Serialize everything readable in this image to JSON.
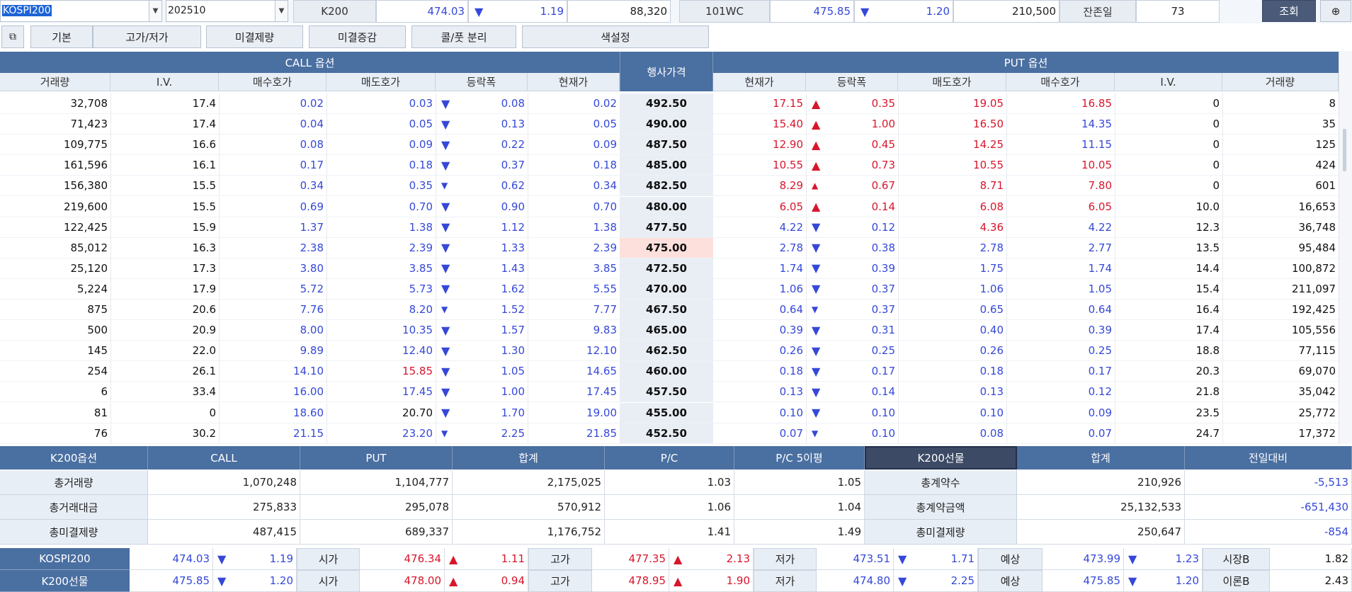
{
  "toolbar": {
    "underlying_value": "KOSPI200",
    "month_value": "202510",
    "k200_label": "K200",
    "k200_price": "474.03",
    "k200_change": "1.19",
    "k200_volume": "88,320",
    "future_label": "101WC",
    "future_price": "475.85",
    "future_change": "1.20",
    "future_volume": "210,500",
    "days_label": "잔존일",
    "days_value": "73",
    "query_button": "조회",
    "pin_icon": "⊕"
  },
  "tabs": [
    "기본",
    "고가/저가",
    "미결제량",
    "미결증감",
    "콜/풋 분리",
    "색설정"
  ],
  "grid": {
    "call_header": "CALL 옵션",
    "put_header": "PUT 옵션",
    "strike_header": "행사가격",
    "call_cols": [
      "거래량",
      "I.V.",
      "매수호가",
      "매도호가",
      "등락폭",
      "현재가"
    ],
    "put_cols": [
      "현재가",
      "등락폭",
      "매도호가",
      "매수호가",
      "I.V.",
      "거래량"
    ],
    "rows": [
      {
        "cv": "32,708",
        "civ": "17.4",
        "cb": "0.02",
        "ca": "0.03",
        "cchg": "0.08",
        "cp": "0.02",
        "k": "492.50",
        "pp": "17.15",
        "pchg": "0.35",
        "pa": "19.05",
        "pb": "16.85",
        "piv": "0",
        "pv": "8",
        "cdir": "dn",
        "pdir": "up",
        "csmall": false,
        "psmall": false,
        "ppc": "red",
        "pac": "red",
        "pbc": "red",
        "cbc": "blue",
        "cac": "blue"
      },
      {
        "cv": "71,423",
        "civ": "17.4",
        "cb": "0.04",
        "ca": "0.05",
        "cchg": "0.13",
        "cp": "0.05",
        "k": "490.00",
        "pp": "15.40",
        "pchg": "1.00",
        "pa": "16.50",
        "pb": "14.35",
        "piv": "0",
        "pv": "35",
        "cdir": "dn",
        "pdir": "up",
        "csmall": false,
        "psmall": false,
        "ppc": "red",
        "pac": "red",
        "pbc": "blue",
        "cbc": "blue",
        "cac": "blue"
      },
      {
        "cv": "109,775",
        "civ": "16.6",
        "cb": "0.08",
        "ca": "0.09",
        "cchg": "0.22",
        "cp": "0.09",
        "k": "487.50",
        "pp": "12.90",
        "pchg": "0.45",
        "pa": "14.25",
        "pb": "11.15",
        "piv": "0",
        "pv": "125",
        "cdir": "dn",
        "pdir": "up",
        "csmall": false,
        "psmall": false,
        "ppc": "red",
        "pac": "red",
        "pbc": "blue",
        "cbc": "blue",
        "cac": "blue"
      },
      {
        "cv": "161,596",
        "civ": "16.1",
        "cb": "0.17",
        "ca": "0.18",
        "cchg": "0.37",
        "cp": "0.18",
        "k": "485.00",
        "pp": "10.55",
        "pchg": "0.73",
        "pa": "10.55",
        "pb": "10.05",
        "piv": "0",
        "pv": "424",
        "cdir": "dn",
        "pdir": "up",
        "csmall": false,
        "psmall": false,
        "ppc": "red",
        "pac": "red",
        "pbc": "red",
        "cbc": "blue",
        "cac": "blue"
      },
      {
        "cv": "156,380",
        "civ": "15.5",
        "cb": "0.34",
        "ca": "0.35",
        "cchg": "0.62",
        "cp": "0.34",
        "k": "482.50",
        "pp": "8.29",
        "pchg": "0.67",
        "pa": "8.71",
        "pb": "7.80",
        "piv": "0",
        "pv": "601",
        "cdir": "dn",
        "pdir": "up",
        "csmall": true,
        "psmall": true,
        "ppc": "red",
        "pac": "red",
        "pbc": "red",
        "cbc": "blue",
        "cac": "blue"
      },
      {
        "cv": "219,600",
        "civ": "15.5",
        "cb": "0.69",
        "ca": "0.70",
        "cchg": "0.90",
        "cp": "0.70",
        "k": "480.00",
        "pp": "6.05",
        "pchg": "0.14",
        "pa": "6.08",
        "pb": "6.05",
        "piv": "10.0",
        "pv": "16,653",
        "cdir": "dn",
        "pdir": "up",
        "csmall": false,
        "psmall": false,
        "ppc": "red",
        "pac": "red",
        "pbc": "red",
        "cbc": "blue",
        "cac": "blue"
      },
      {
        "cv": "122,425",
        "civ": "15.9",
        "cb": "1.37",
        "ca": "1.38",
        "cchg": "1.12",
        "cp": "1.38",
        "k": "477.50",
        "pp": "4.22",
        "pchg": "0.12",
        "pa": "4.36",
        "pb": "4.22",
        "piv": "12.3",
        "pv": "36,748",
        "cdir": "dn",
        "pdir": "dn",
        "csmall": false,
        "psmall": false,
        "ppc": "blue",
        "pac": "red",
        "pbc": "blue",
        "cbc": "blue",
        "cac": "blue"
      },
      {
        "cv": "85,012",
        "civ": "16.3",
        "cb": "2.38",
        "ca": "2.39",
        "cchg": "1.33",
        "cp": "2.39",
        "k": "475.00",
        "pp": "2.78",
        "pchg": "0.38",
        "pa": "2.78",
        "pb": "2.77",
        "piv": "13.5",
        "pv": "95,484",
        "cdir": "dn",
        "pdir": "dn",
        "csmall": false,
        "psmall": false,
        "ppc": "blue",
        "pac": "blue",
        "pbc": "blue",
        "cbc": "blue",
        "cac": "blue",
        "atm": true
      },
      {
        "cv": "25,120",
        "civ": "17.3",
        "cb": "3.80",
        "ca": "3.85",
        "cchg": "1.43",
        "cp": "3.85",
        "k": "472.50",
        "pp": "1.74",
        "pchg": "0.39",
        "pa": "1.75",
        "pb": "1.74",
        "piv": "14.4",
        "pv": "100,872",
        "cdir": "dn",
        "pdir": "dn",
        "csmall": false,
        "psmall": false,
        "ppc": "blue",
        "pac": "blue",
        "pbc": "blue",
        "cbc": "blue",
        "cac": "blue"
      },
      {
        "cv": "5,224",
        "civ": "17.9",
        "cb": "5.72",
        "ca": "5.73",
        "cchg": "1.62",
        "cp": "5.55",
        "k": "470.00",
        "pp": "1.06",
        "pchg": "0.37",
        "pa": "1.06",
        "pb": "1.05",
        "piv": "15.4",
        "pv": "211,097",
        "cdir": "dn",
        "pdir": "dn",
        "csmall": false,
        "psmall": false,
        "ppc": "blue",
        "pac": "blue",
        "pbc": "blue",
        "cbc": "blue",
        "cac": "blue"
      },
      {
        "cv": "875",
        "civ": "20.6",
        "cb": "7.76",
        "ca": "8.20",
        "cchg": "1.52",
        "cp": "7.77",
        "k": "467.50",
        "pp": "0.64",
        "pchg": "0.37",
        "pa": "0.65",
        "pb": "0.64",
        "piv": "16.4",
        "pv": "192,425",
        "cdir": "dn",
        "pdir": "dn",
        "csmall": true,
        "psmall": true,
        "ppc": "blue",
        "pac": "blue",
        "pbc": "blue",
        "cbc": "blue",
        "cac": "blue"
      },
      {
        "cv": "500",
        "civ": "20.9",
        "cb": "8.00",
        "ca": "10.35",
        "cchg": "1.57",
        "cp": "9.83",
        "k": "465.00",
        "pp": "0.39",
        "pchg": "0.31",
        "pa": "0.40",
        "pb": "0.39",
        "piv": "17.4",
        "pv": "105,556",
        "cdir": "dn",
        "pdir": "dn",
        "csmall": false,
        "psmall": false,
        "ppc": "blue",
        "pac": "blue",
        "pbc": "blue",
        "cbc": "blue",
        "cac": "blue"
      },
      {
        "cv": "145",
        "civ": "22.0",
        "cb": "9.89",
        "ca": "12.40",
        "cchg": "1.30",
        "cp": "12.10",
        "k": "462.50",
        "pp": "0.26",
        "pchg": "0.25",
        "pa": "0.26",
        "pb": "0.25",
        "piv": "18.8",
        "pv": "77,115",
        "cdir": "dn",
        "pdir": "dn",
        "csmall": false,
        "psmall": false,
        "ppc": "blue",
        "pac": "blue",
        "pbc": "blue",
        "cbc": "blue",
        "cac": "blue"
      },
      {
        "cv": "254",
        "civ": "26.1",
        "cb": "14.10",
        "ca": "15.85",
        "cchg": "1.05",
        "cp": "14.65",
        "k": "460.00",
        "pp": "0.18",
        "pchg": "0.17",
        "pa": "0.18",
        "pb": "0.17",
        "piv": "20.3",
        "pv": "69,070",
        "cdir": "dn",
        "pdir": "dn",
        "csmall": false,
        "psmall": false,
        "ppc": "blue",
        "pac": "blue",
        "pbc": "blue",
        "cbc": "blue",
        "cac": "red"
      },
      {
        "cv": "6",
        "civ": "33.4",
        "cb": "16.00",
        "ca": "17.45",
        "cchg": "1.00",
        "cp": "17.45",
        "k": "457.50",
        "pp": "0.13",
        "pchg": "0.14",
        "pa": "0.13",
        "pb": "0.12",
        "piv": "21.8",
        "pv": "35,042",
        "cdir": "dn",
        "pdir": "dn",
        "csmall": false,
        "psmall": false,
        "ppc": "blue",
        "pac": "blue",
        "pbc": "blue",
        "cbc": "blue",
        "cac": "blue"
      },
      {
        "cv": "81",
        "civ": "0",
        "cb": "18.60",
        "ca": "20.70",
        "cchg": "1.70",
        "cp": "19.00",
        "k": "455.00",
        "pp": "0.10",
        "pchg": "0.10",
        "pa": "0.10",
        "pb": "0.09",
        "piv": "23.5",
        "pv": "25,772",
        "cdir": "dn",
        "pdir": "dn",
        "csmall": false,
        "psmall": false,
        "ppc": "blue",
        "pac": "blue",
        "pbc": "blue",
        "cbc": "blue",
        "cac": "black"
      },
      {
        "cv": "76",
        "civ": "30.2",
        "cb": "21.15",
        "ca": "23.20",
        "cchg": "2.25",
        "cp": "21.85",
        "k": "452.50",
        "pp": "0.07",
        "pchg": "0.10",
        "pa": "0.08",
        "pb": "0.07",
        "piv": "24.7",
        "pv": "17,372",
        "cdir": "dn",
        "pdir": "dn",
        "csmall": true,
        "psmall": true,
        "ppc": "blue",
        "pac": "blue",
        "pbc": "blue",
        "cbc": "blue",
        "cac": "blue"
      }
    ]
  },
  "summary": {
    "headers": [
      "K200옵션",
      "CALL",
      "PUT",
      "합계",
      "P/C",
      "P/C 5이평",
      "K200선물",
      "합계",
      "전일대비"
    ],
    "rows": [
      {
        "label": "총거래량",
        "call": "1,070,248",
        "put": "1,104,777",
        "sum": "2,175,025",
        "pc": "1.03",
        "pc5": "1.05",
        "flabel": "총계약수",
        "fsum": "210,926",
        "fchg": "-5,513"
      },
      {
        "label": "총거래대금",
        "call": "275,833",
        "put": "295,078",
        "sum": "570,912",
        "pc": "1.06",
        "pc5": "1.04",
        "flabel": "총계약금액",
        "fsum": "25,132,533",
        "fchg": "-651,430"
      },
      {
        "label": "총미결제량",
        "call": "487,415",
        "put": "689,337",
        "sum": "1,176,752",
        "pc": "1.41",
        "pc5": "1.49",
        "flabel": "총미결제량",
        "fsum": "250,647",
        "fchg": "-854"
      }
    ]
  },
  "ticker": {
    "rows": [
      {
        "name": "KOSPI200",
        "price": "474.03",
        "chg": "1.19",
        "open_lbl": "시가",
        "open": "476.34",
        "open_chg": "1.11",
        "high_lbl": "고가",
        "high": "477.35",
        "high_chg": "2.13",
        "low_lbl": "저가",
        "low": "473.51",
        "low_chg": "1.71",
        "exp_lbl": "예상",
        "exp": "473.99",
        "exp_chg": "1.23",
        "basis_lbl": "시장B",
        "basis": "1.82"
      },
      {
        "name": "K200선물",
        "price": "475.85",
        "chg": "1.20",
        "open_lbl": "시가",
        "open": "478.00",
        "open_chg": "0.94",
        "high_lbl": "고가",
        "high": "478.95",
        "high_chg": "1.90",
        "low_lbl": "저가",
        "low": "474.80",
        "low_chg": "2.25",
        "exp_lbl": "예상",
        "exp": "475.85",
        "exp_chg": "1.20",
        "basis_lbl": "이론B",
        "basis": "2.43"
      }
    ]
  },
  "colors": {
    "header_blue": "#4a6fa1",
    "up_red": "#d8162c",
    "down_blue": "#3548d8",
    "atm_pink": "#fde0dc"
  }
}
